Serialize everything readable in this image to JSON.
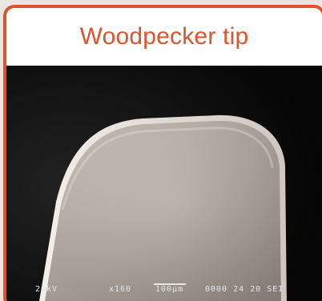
{
  "title": "Woodpecker tip",
  "micrograph": {
    "voltage": "20kV",
    "magnification": "x160",
    "scale_bar": "100µm",
    "code": "0000 24 20 SEI"
  }
}
